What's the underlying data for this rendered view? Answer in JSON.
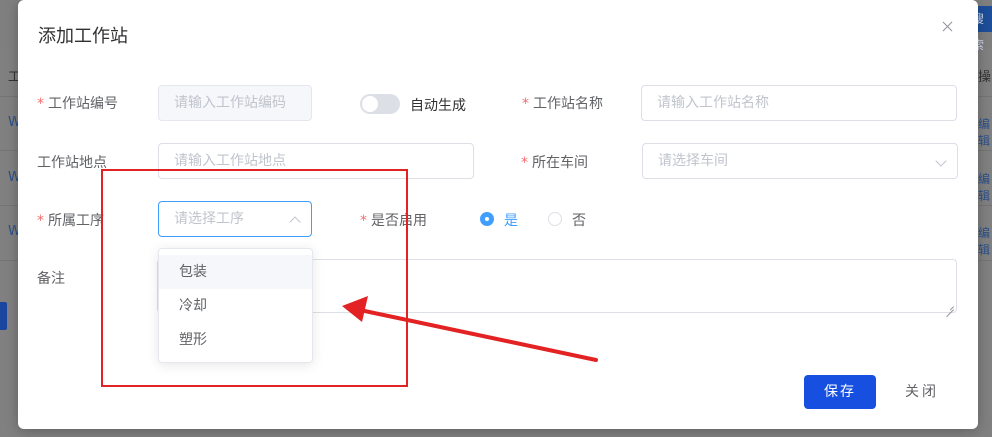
{
  "background": {
    "search_button_text": "搜索",
    "header_col_left": "工",
    "header_col_right": "操",
    "row_cells": [
      "W",
      "W",
      "W"
    ],
    "row_ops": [
      "编辑",
      "编辑",
      "编辑"
    ]
  },
  "dialog": {
    "title": "添加工作站",
    "close_icon": "close-icon"
  },
  "form": {
    "required_mark": "*",
    "station_code": {
      "label": "工作站编号",
      "placeholder": "请输入工作站编码",
      "required": true
    },
    "auto_generate": {
      "label": "自动生成",
      "enabled": false
    },
    "station_name": {
      "label": "工作站名称",
      "placeholder": "请输入工作站名称",
      "required": true
    },
    "station_location": {
      "label": "工作站地点",
      "placeholder": "请输入工作站地点",
      "required": false
    },
    "workshop": {
      "label": "所在车间",
      "placeholder": "请选择车间",
      "required": true
    },
    "process": {
      "label": "所属工序",
      "placeholder": "请选择工序",
      "required": true,
      "options": [
        "包装",
        "冷却",
        "塑形"
      ],
      "hovered_option": "包装"
    },
    "enabled": {
      "label": "是否启用",
      "required": true,
      "options": [
        "是",
        "否"
      ],
      "selected": "是"
    },
    "remark": {
      "label": "备注",
      "value": ""
    }
  },
  "footer": {
    "save_label": "保存",
    "close_label": "关闭"
  },
  "colors": {
    "primary": "#1750e0",
    "focus": "#409eff",
    "required": "#f56c6c",
    "annotation": "#e32323"
  }
}
